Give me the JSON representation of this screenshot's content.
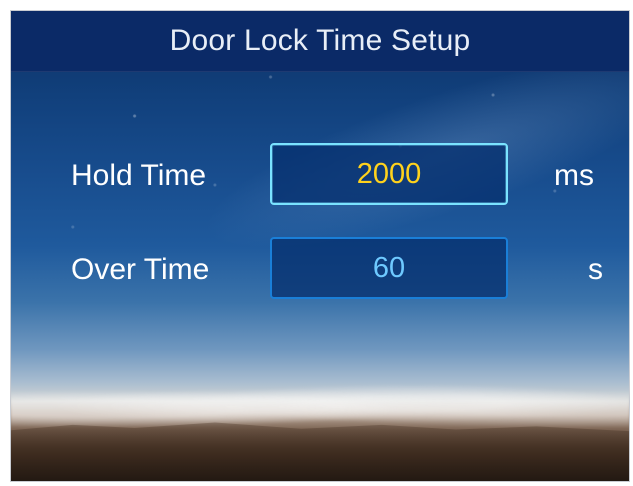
{
  "screen": {
    "title": "Door Lock Time Setup",
    "rows": [
      {
        "label": "Hold Time",
        "value": "2000",
        "unit": "ms",
        "state": "active"
      },
      {
        "label": "Over Time",
        "value": "60",
        "unit": "s",
        "state": "inactive"
      }
    ]
  },
  "colors": {
    "title_bar": "#0b2a67",
    "active_value": "#ffd21c",
    "active_border": "#7ae3ff",
    "inactive_value": "#6ec9ff",
    "inactive_border": "#1a7fd8",
    "label_text": "#ffffff"
  }
}
